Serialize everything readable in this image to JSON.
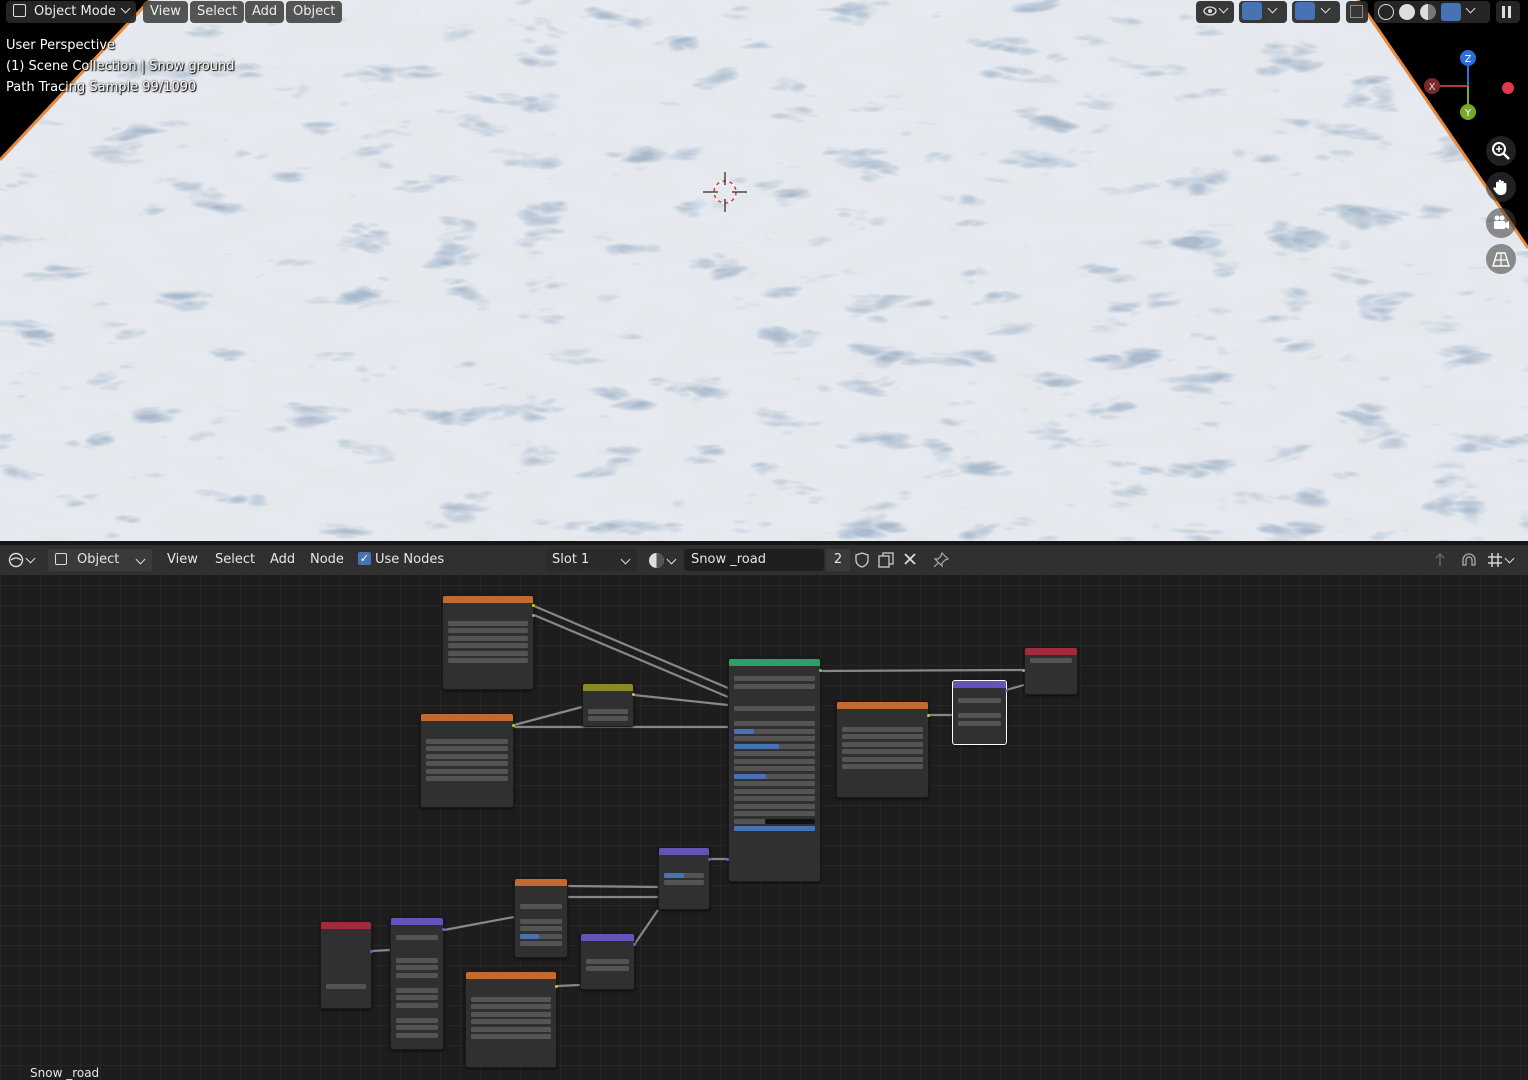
{
  "viewport": {
    "header": {
      "mode": "Object Mode",
      "menus": [
        "View",
        "Select",
        "Add",
        "Object"
      ]
    },
    "overlay": {
      "perspective": "User Perspective",
      "collection": "(1) Scene Collection | Snow ground",
      "render_status": "Path Tracing Sample 99/1090"
    },
    "gizmo": {
      "x_label": "X",
      "y_label": "Y",
      "z_label": "Z"
    },
    "tools": [
      "zoom-icon",
      "pan-hand-icon",
      "camera-icon",
      "grid-icon"
    ]
  },
  "node_editor": {
    "header": {
      "object_selector": "Object",
      "menus": [
        "View",
        "Select",
        "Add",
        "Node"
      ],
      "use_nodes_label": "Use Nodes",
      "use_nodes_checked": true,
      "slot": "Slot 1",
      "material_name": "Snow _road",
      "user_count": "2"
    },
    "status_text": "Snow _road"
  },
  "colors": {
    "viewport_border_orange": "#e58a3c",
    "node_texture_header": "#c26a30",
    "node_shader_header": "#2f9e6a",
    "node_vector_header": "#6355b8",
    "node_output_header": "#a32a3a",
    "node_color_header": "#8a8a2a",
    "selection_white": "#ffffff"
  }
}
